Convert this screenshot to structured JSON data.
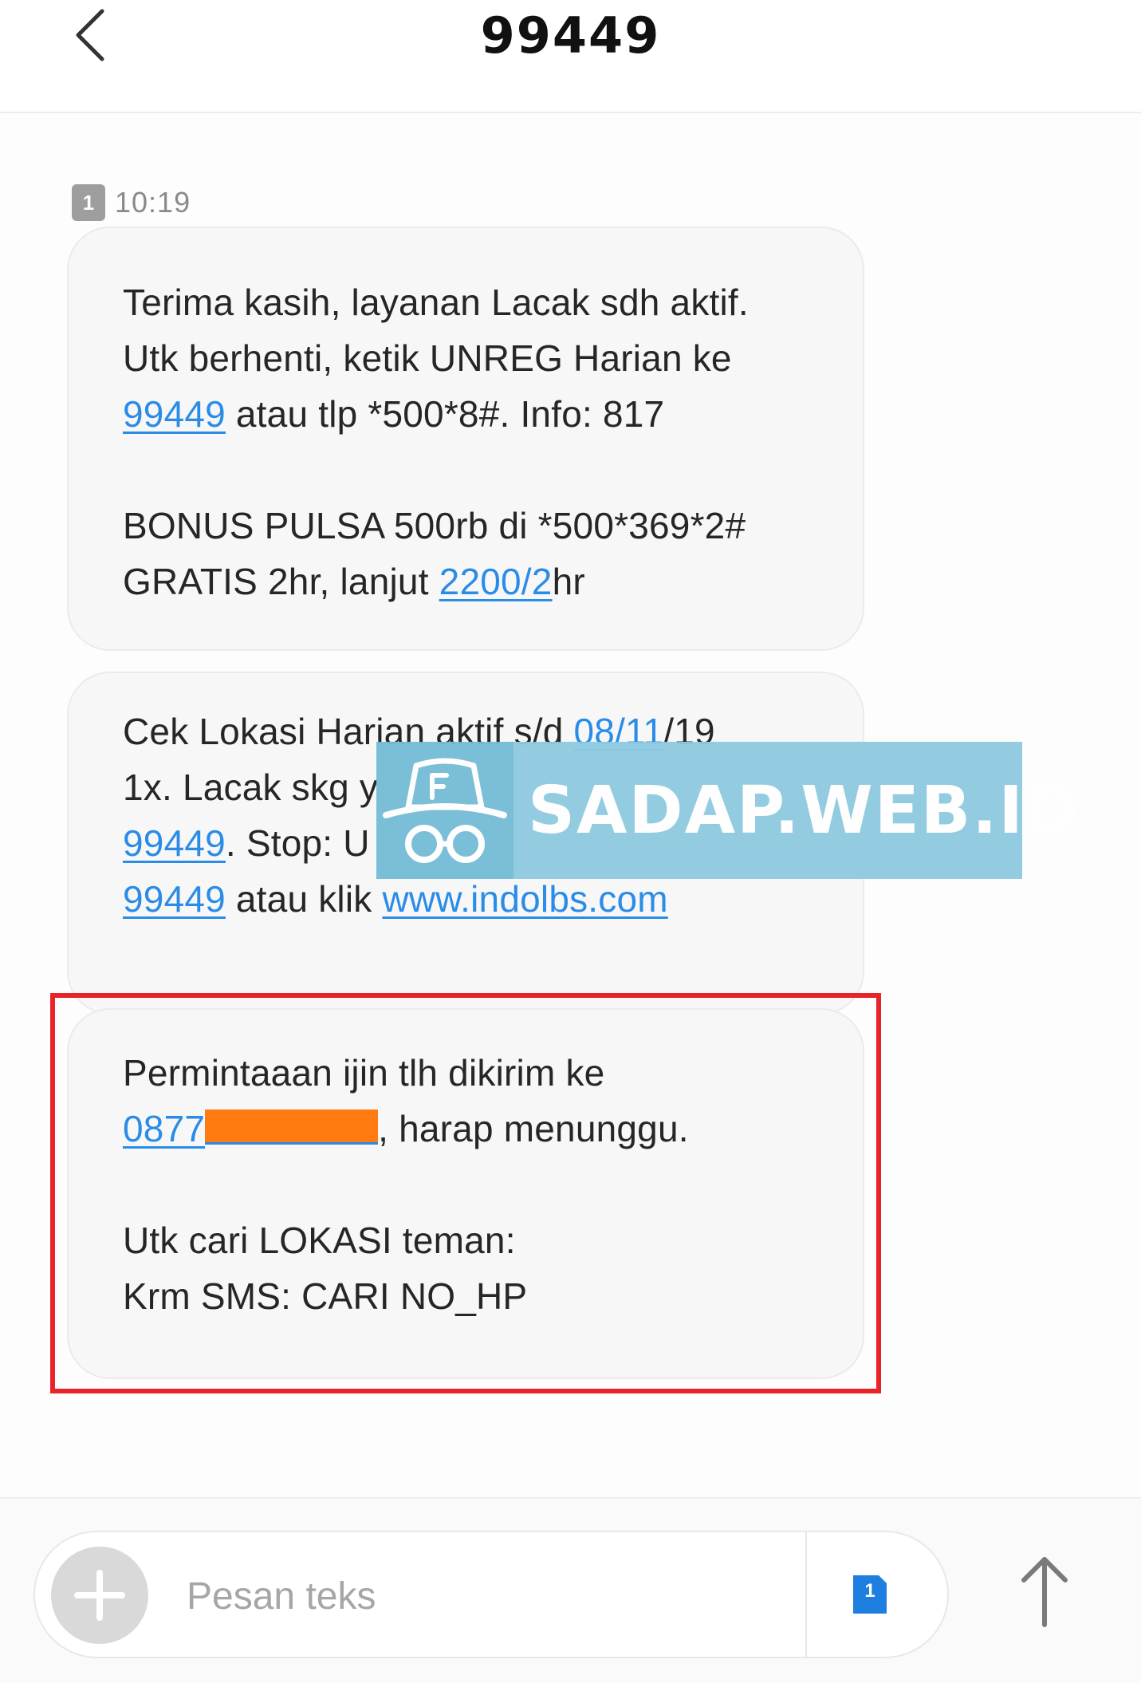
{
  "header": {
    "title": "99449"
  },
  "conversation": {
    "sim_badge": "1",
    "time": "10:19",
    "messages": [
      {
        "lines": [
          "Terima kasih, layanan Lacak sdh aktif.",
          "Utk berhenti, ketik UNREG Harian ke",
          {
            "link": "99449",
            "text": " atau tlp *500*8#. Info: 817"
          },
          "",
          "BONUS PULSA 500rb di *500*369*2#",
          {
            "pre": "GRATIS 2hr, lanjut ",
            "link": "2200/2",
            "text": "hr"
          }
        ]
      },
      {
        "lines": [
          "Cek Lokasi Harian aktif s/d 08/11/19",
          "1x. Lacak skg y",
          {
            "link": "99449",
            "text": ". Stop: U"
          },
          {
            "link": "99449",
            "text": " atau klik ",
            "link2": "www.indolbs.com"
          }
        ]
      },
      {
        "lines": [
          "Permintaaan ijin tlh dikirim ke",
          {
            "link": "0877",
            "text": ", harap menunggu."
          },
          "",
          "Utk cari LOKASI teman:",
          "Krm SMS: CARI NO_HP"
        ]
      }
    ]
  },
  "watermark": {
    "text": "SADAP.WEB.ID"
  },
  "composer": {
    "placeholder": "Pesan teks",
    "sim_label": "1"
  },
  "colors": {
    "link": "#2b8ce8",
    "highlight": "#e8232a",
    "redaction": "#ff7a10",
    "watermark": "#8fcbe0"
  }
}
